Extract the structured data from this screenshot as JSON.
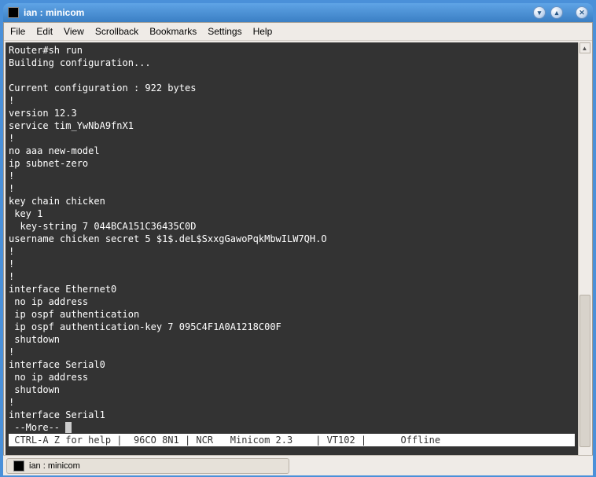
{
  "window": {
    "title": "ian : minicom"
  },
  "menu": {
    "file": "File",
    "edit": "Edit",
    "view": "View",
    "scrollback": "Scrollback",
    "bookmarks": "Bookmarks",
    "settings": "Settings",
    "help": "Help"
  },
  "terminal": {
    "lines": [
      "Router#sh run",
      "Building configuration...",
      "",
      "Current configuration : 922 bytes",
      "!",
      "version 12.3",
      "service tim_YwNbA9fnX1",
      "!",
      "no aaa new-model",
      "ip subnet-zero",
      "!",
      "!",
      "key chain chicken",
      " key 1",
      "  key-string 7 044BCA151C36435C0D",
      "username chicken secret 5 $1$.deL$SxxgGawoPqkMbwILW7QH.O",
      "!",
      "!",
      "!",
      "interface Ethernet0",
      " no ip address",
      " ip ospf authentication",
      " ip ospf authentication-key 7 095C4F1A0A1218C00F",
      " shutdown",
      "!",
      "interface Serial0",
      " no ip address",
      " shutdown",
      "!",
      "interface Serial1",
      " --More-- "
    ],
    "status": " CTRL-A Z for help |  96CO 8N1 | NCR   Minicom 2.3    | VT102 |      Offline                   "
  },
  "taskbar": {
    "item": "ian : minicom"
  }
}
